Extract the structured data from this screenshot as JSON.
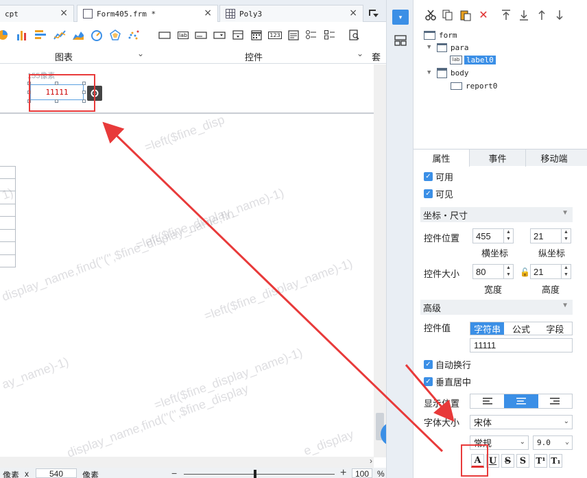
{
  "tabs": [
    {
      "label": "cpt",
      "close": "×"
    },
    {
      "label": "Form405.frm *",
      "close": "×"
    },
    {
      "label": "Poly3",
      "close": "×"
    }
  ],
  "toolbar": {
    "chart_group_label": "图表",
    "widget_group_label": "控件",
    "template_group_label": "套用",
    "widget_icon_text_label": "lab",
    "widget_icon_text_number": "123"
  },
  "canvas": {
    "ruler_hint": "155像素",
    "label_widget_text": "11111",
    "watermarks": [
      "=left($fine_disp",
      "1)",
      "=left($fine_display_name)-1)",
      "display_name,find(\"(\",$fine_display_name,fin",
      "=left($fine_display_name)-1)",
      "ay_name)-1)",
      "=left($fine_display_name)-1)",
      "display_name,find(\"(\",$fine_display",
      "e_display"
    ]
  },
  "status": {
    "unit1": "像素",
    "x_label": "x",
    "x_value": "540",
    "unit2": "像素",
    "zoom_minus": "−",
    "zoom_plus": "+",
    "zoom_value": "100",
    "zoom_unit": "%"
  },
  "help": {
    "label": "?"
  },
  "tree": {
    "root": "form",
    "para": "para",
    "label0": "label0",
    "body": "body",
    "report0": "report0",
    "label_icon_text": "lab"
  },
  "props_tabs": [
    "属性",
    "事件",
    "移动端"
  ],
  "props": {
    "enabled_label": "可用",
    "visible_label": "可见",
    "section_coord": "坐标・尺寸",
    "position_label": "控件位置",
    "pos_x": "455",
    "pos_y": "21",
    "pos_x_caption": "横坐标",
    "pos_y_caption": "纵坐标",
    "size_label": "控件大小",
    "width": "80",
    "height": "21",
    "width_caption": "宽度",
    "height_caption": "高度",
    "section_advanced": "高级",
    "value_label": "控件值",
    "value_types": [
      "字符串",
      "公式",
      "字段"
    ],
    "value": "11111",
    "wrap_label": "自动换行",
    "vcenter_label": "垂直居中",
    "display_pos_label": "显示位置",
    "font_size_label": "字体大小",
    "font_family": "宋体",
    "font_style": "常规",
    "font_size": "9.0",
    "fmt_buttons": [
      "A",
      "U",
      "S",
      "S",
      "T¹",
      "T₁"
    ]
  },
  "colors": {
    "accent": "#3b8fe6",
    "annotation": "#e83a3a",
    "label_text": "#cc0000"
  }
}
